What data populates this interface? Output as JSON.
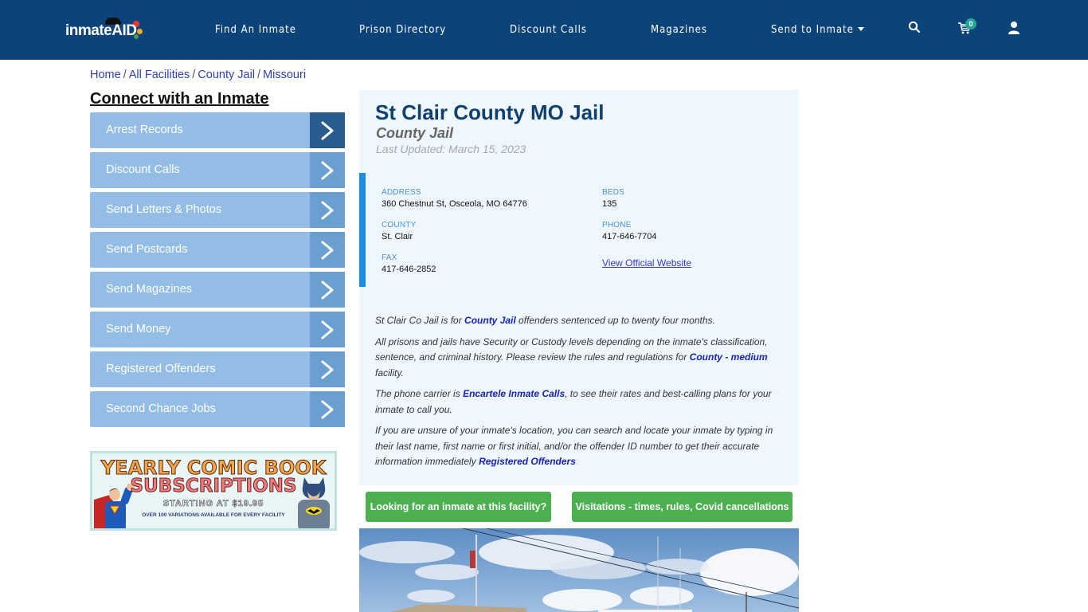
{
  "header": {
    "logo": {
      "text_left": "inmate",
      "text_right": "AID"
    },
    "nav": [
      {
        "label": "Find An Inmate"
      },
      {
        "label": "Prison Directory"
      },
      {
        "label": "Discount Calls"
      },
      {
        "label": "Magazines"
      },
      {
        "label": "Send to Inmate",
        "has_dropdown": true
      }
    ],
    "icons": {
      "search": "search-icon",
      "cart": "cart-icon",
      "user": "user-icon"
    },
    "cart_count": "0"
  },
  "breadcrumb": [
    "Home",
    "All Facilities",
    "County Jail",
    "Missouri"
  ],
  "sidebar": {
    "title": "Connect with an Inmate",
    "items": [
      {
        "label": "Arrest Records",
        "active": true
      },
      {
        "label": "Discount Calls"
      },
      {
        "label": "Send Letters & Photos"
      },
      {
        "label": "Send Postcards"
      },
      {
        "label": "Send Magazines"
      },
      {
        "label": "Send Money"
      },
      {
        "label": "Registered Offenders"
      },
      {
        "label": "Second Chance Jobs"
      }
    ],
    "ad": {
      "line1": "YEARLY COMIC BOOK",
      "line2": "SUBSCRIPTIONS",
      "line3": "STARTING AT $19.95",
      "line4": "OVER 100 VARIATIONS AVAILABLE FOR EVERY FACILITY"
    }
  },
  "facility": {
    "name": "St Clair County MO Jail",
    "type": "County Jail",
    "last_updated": "Last Updated: March 15, 2023",
    "fields": {
      "address_label": "ADDRESS",
      "address": "360 Chestnut St, Osceola, MO 64776",
      "county_label": "COUNTY",
      "county": "St. Clair",
      "fax_label": "FAX",
      "fax": "417-646-2852",
      "beds_label": "BEDS",
      "beds": "135",
      "phone_label": "PHONE",
      "phone": "417-646-7704",
      "website_link": "View Official Website"
    },
    "description": {
      "p1_a": "St Clair Co Jail is for ",
      "p1_link": "County Jail",
      "p1_b": " offenders sentenced up to twenty four months.",
      "p2_a": "All prisons and jails have Security or Custody levels depending on the inmate's classification, sentence, and criminal history. Please review the rules and regulations for ",
      "p2_link": "County - medium",
      "p2_b": " facility.",
      "p3_a": "The phone carrier is ",
      "p3_link": "Encartele Inmate Calls",
      "p3_b": ", to see their rates and best-calling plans for your inmate to call you.",
      "p4_a": "If you are unsure of your inmate's location, you can search and locate your inmate by typing in their last name, first name or first initial, and/or the offender ID number to get their accurate information immediately ",
      "p4_link": "Registered Offenders"
    },
    "buttons": {
      "find_inmate": "Looking for an inmate at this facility?",
      "visitations": "Visitations - times, rules, Covid cancellations"
    }
  },
  "colors": {
    "header_bg": "#0c4378",
    "sidebar_item": "#94bde6",
    "sidebar_arrow": "#6a9fd0",
    "sidebar_arrow_active": "#2a5b8f",
    "panel_bg": "#edf7fd",
    "accent_bar": "#1a8be8",
    "green_button": "#4caf50"
  }
}
